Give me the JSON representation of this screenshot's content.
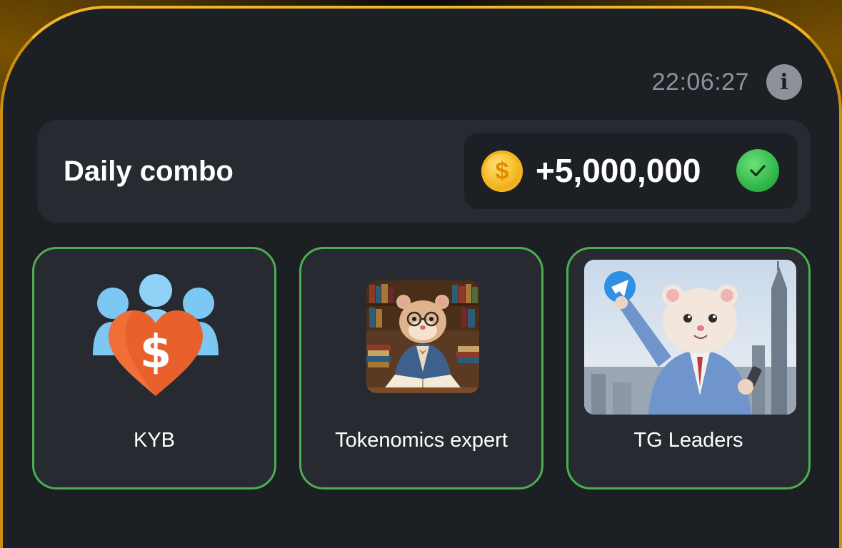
{
  "timer": {
    "value": "22:06:27"
  },
  "daily_combo": {
    "title": "Daily combo",
    "reward": "+5,000,000",
    "coin_symbol": "$",
    "claimed": true
  },
  "cards": [
    {
      "label": "KYB",
      "icon": "kyb-heart-dollar-icon"
    },
    {
      "label": "Tokenomics expert",
      "icon": "hamster-reading-book-image"
    },
    {
      "label": "TG Leaders",
      "icon": "hamster-telegram-city-image"
    }
  ],
  "colors": {
    "panel": "#1c1f24",
    "accent_gold": "#f0b429",
    "card_border": "#4caf50",
    "check_green": "#33b84a"
  }
}
